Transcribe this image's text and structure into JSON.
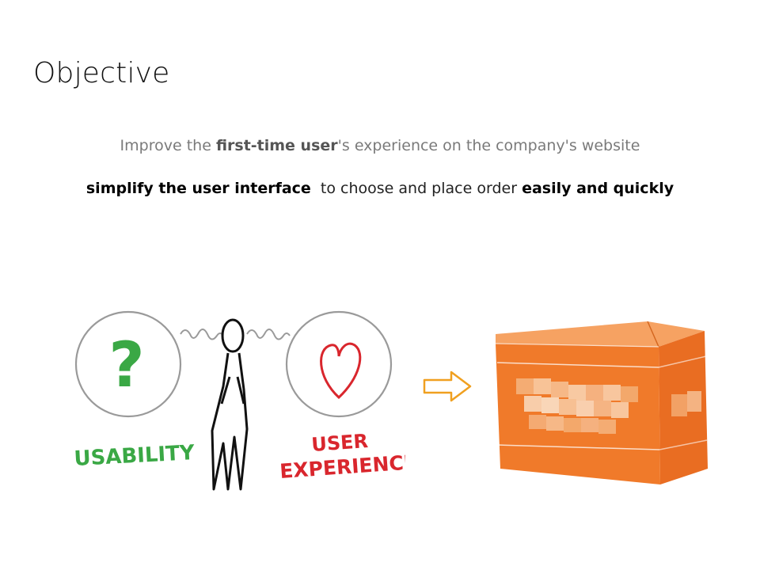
{
  "slide": {
    "title": "Objective",
    "line1": {
      "before": "Improve the ",
      "emphasis": "first-time user",
      "after": "'s experience on the company's website"
    },
    "line2": {
      "emphasis_start": "simplify the user interface",
      "middle": "to choose and place order",
      "emphasis_end": "easily and quickly"
    }
  },
  "illustration": {
    "left_label": "USABILITY",
    "right_label_line1": "USER",
    "right_label_line2": "EXPERIENCE",
    "question_mark": "?",
    "colors": {
      "usability": "#3aa845",
      "experience": "#d9262d",
      "ink": "#111111",
      "circle": "#9a9a9a"
    }
  },
  "arrow": {
    "color": "#f0a020",
    "icon": "right-arrow-icon"
  },
  "box": {
    "color": "#f07a2a",
    "icon": "shipping-box-image"
  }
}
